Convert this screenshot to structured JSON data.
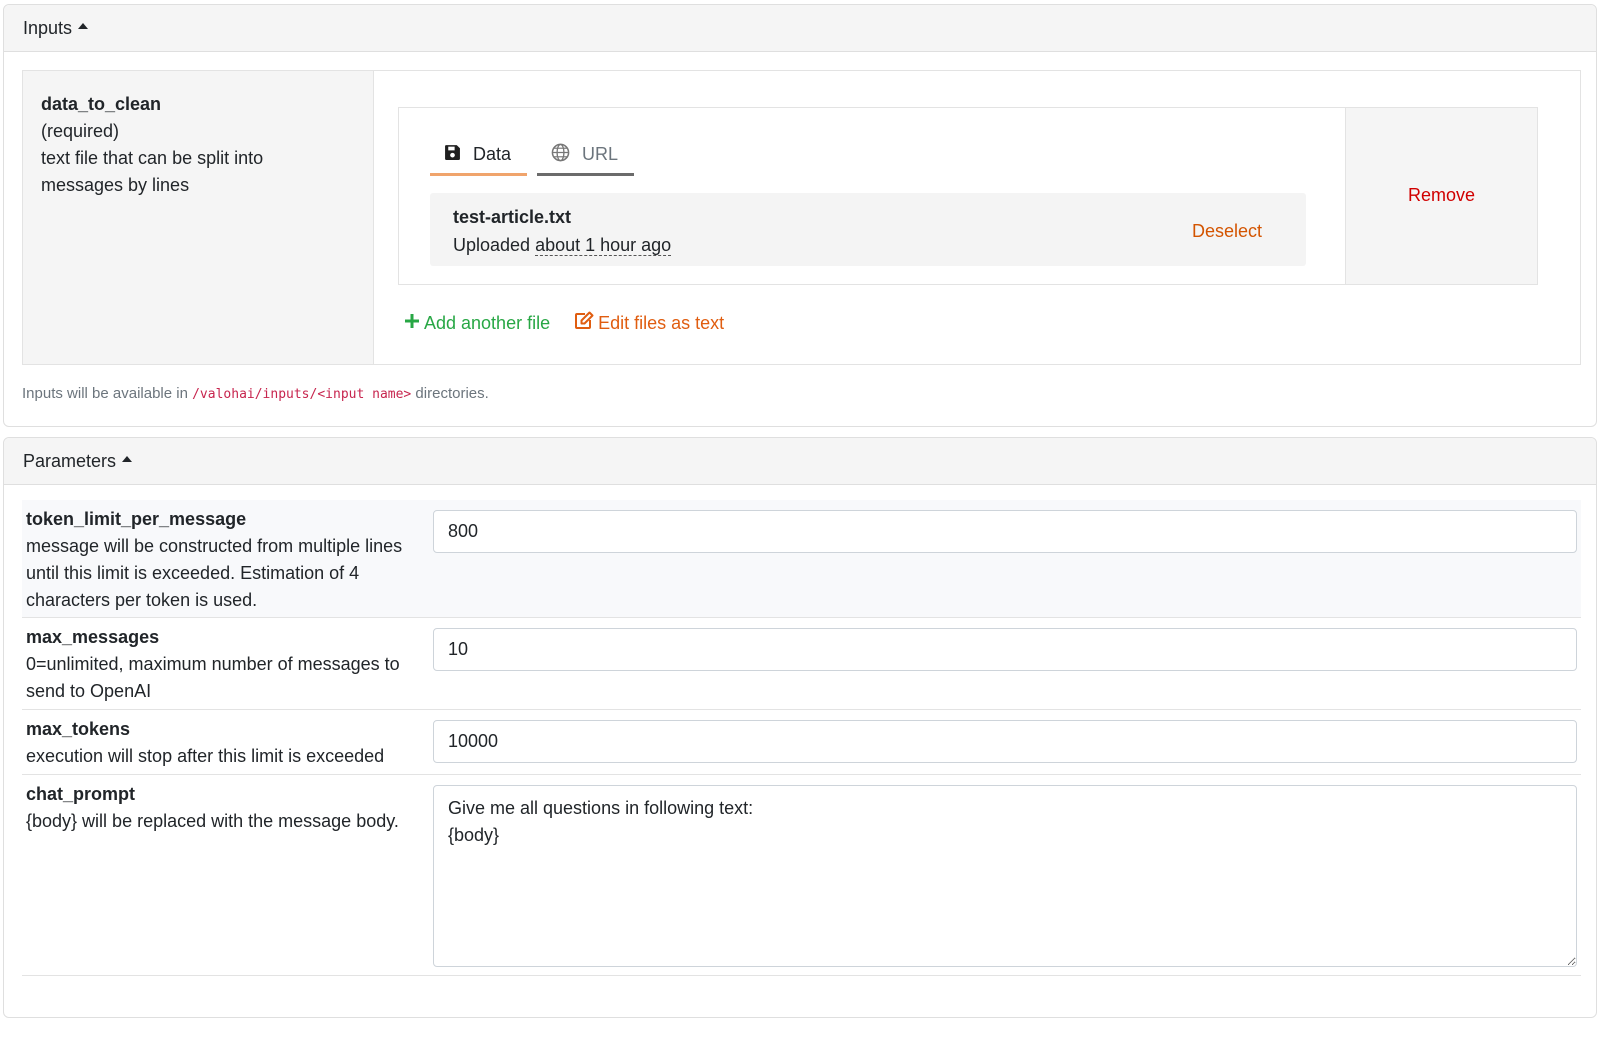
{
  "inputs": {
    "header": "Inputs",
    "item": {
      "name": "data_to_clean",
      "required": "(required)",
      "description_line1": "text file that can be split into",
      "description_line2": "messages by lines",
      "tabs": [
        {
          "label": "Data",
          "icon": "floppy-disk-icon",
          "active": true
        },
        {
          "label": "URL",
          "icon": "globe-icon",
          "active": false
        }
      ],
      "file": {
        "name": "test-article.txt",
        "uploaded_prefix": "Uploaded ",
        "uploaded_time": "about 1 hour ago",
        "deselect_label": "Deselect"
      },
      "remove_label": "Remove",
      "add_file_label": "Add another file",
      "edit_files_label": "Edit files as text"
    },
    "note_prefix": "Inputs will be available in ",
    "note_path": "/valohai/inputs/<input name>",
    "note_suffix": " directories."
  },
  "parameters": {
    "header": "Parameters",
    "items": [
      {
        "name": "token_limit_per_message",
        "description": "message will be constructed from multiple lines until this limit is exceeded. Estimation of 4 characters per token is used.",
        "value": "800"
      },
      {
        "name": "max_messages",
        "description": "0=unlimited, maximum number of messages to send to OpenAI",
        "value": "10"
      },
      {
        "name": "max_tokens",
        "description": "execution will stop after this limit is exceeded",
        "value": "10000"
      },
      {
        "name": "chat_prompt",
        "description": "{body} will be replaced with the message body.",
        "value": "Give me all questions in following text:\n{body}"
      }
    ]
  },
  "colors": {
    "remove": "#d00000",
    "deselect": "#d35400",
    "add": "#28a745",
    "edit": "#e05d10",
    "tab_active": "#f0a46c",
    "code": "#c7254e"
  }
}
